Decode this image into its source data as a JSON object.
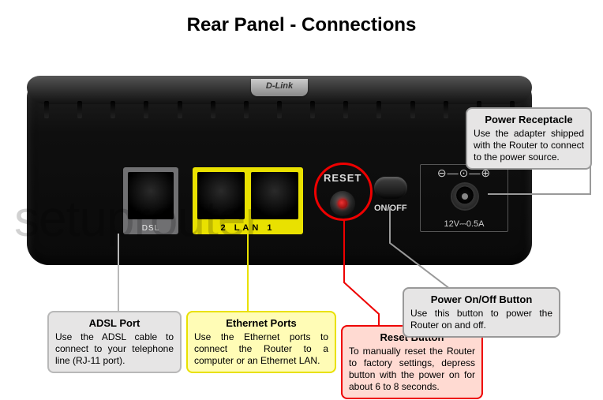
{
  "title": "Rear Panel - Connections",
  "brand": "D-Link",
  "watermark": "setuprouter",
  "panel": {
    "dsl": {
      "label": "DSL"
    },
    "ethernet": {
      "label": "2  LAN  1"
    },
    "reset": {
      "label": "RESET"
    },
    "onoff": {
      "label": "ON/OFF"
    },
    "power": {
      "symbol": "⊖—⊙—⊕",
      "rating": "12V⎓0.5A"
    }
  },
  "callouts": {
    "adsl": {
      "title": "ADSL Port",
      "body": "Use the ADSL cable to connect to your telephone line (RJ-11 port)."
    },
    "ethernet": {
      "title": "Ethernet Ports",
      "body": "Use the Ethernet ports to connect the Router to a computer or an Ethernet LAN."
    },
    "reset": {
      "title": "Reset Button",
      "body": "To manually reset the Router to factory settings, depress button with the power on for about 6 to 8 seconds."
    },
    "onoff": {
      "title": "Power On/Off Button",
      "body": "Use this button to power the Router on and off."
    },
    "power": {
      "title": "Power Receptacle",
      "body": "Use the adapter shipped with the  Router to connect to the power source."
    }
  }
}
